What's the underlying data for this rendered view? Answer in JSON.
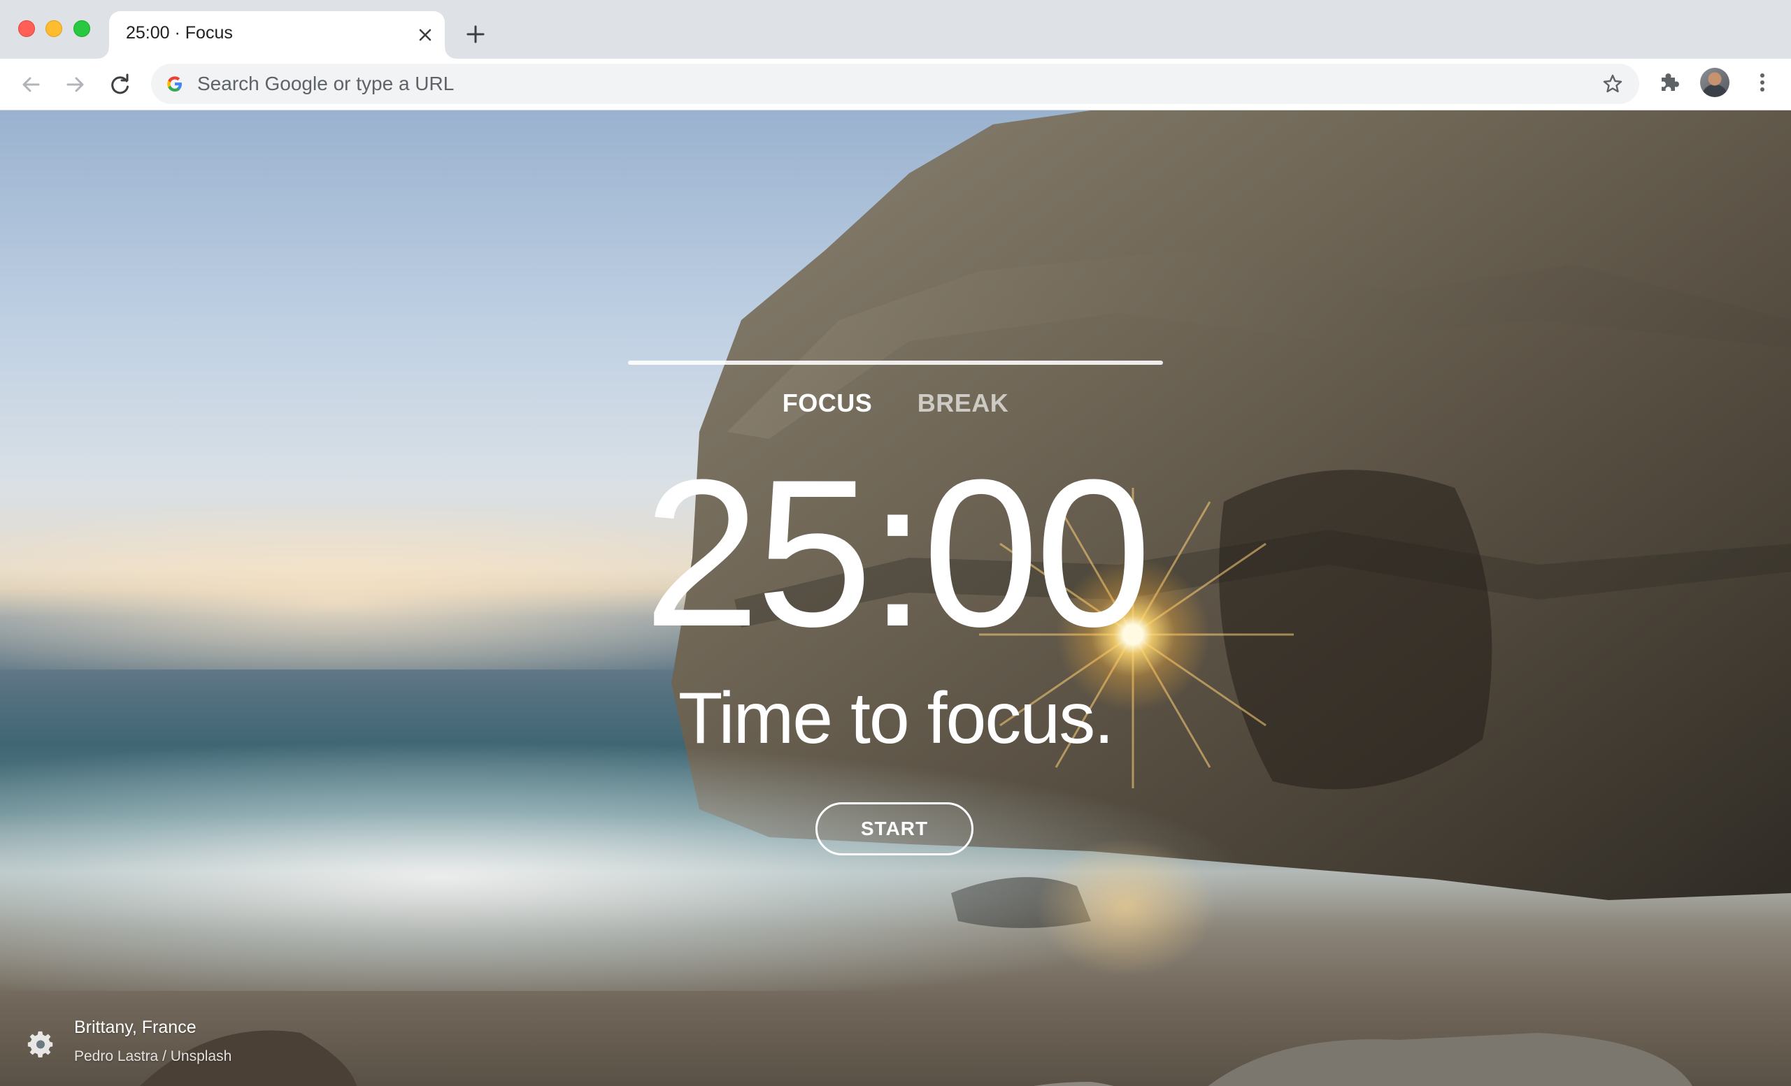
{
  "browser": {
    "tab": {
      "title": "25:00 · Focus"
    },
    "omnibox": {
      "placeholder": "Search Google or type a URL"
    },
    "icons": {
      "back": "arrow-left-icon",
      "forward": "arrow-right-icon",
      "reload": "reload-icon",
      "bookmark": "star-icon",
      "extensions": "puzzle-icon",
      "menu": "kebab-menu-icon"
    }
  },
  "focus": {
    "progress": 1.0,
    "modes": [
      {
        "label": "FOCUS",
        "active": true
      },
      {
        "label": "BREAK",
        "active": false
      }
    ],
    "timer": "25:00",
    "message": "Time to focus.",
    "start_label": "START"
  },
  "photo": {
    "location": "Brittany, France",
    "credit": "Pedro Lastra / Unsplash"
  },
  "colors": {
    "tabstrip": "#dee1e6",
    "toolbar": "#ffffff",
    "omnibox": "#f1f3f4",
    "text_light": "#ffffff"
  }
}
